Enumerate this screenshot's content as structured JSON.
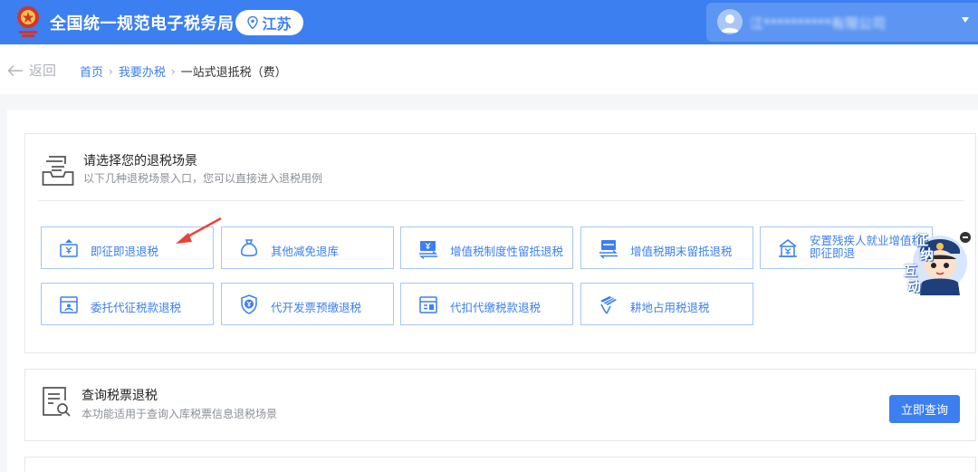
{
  "header": {
    "site_title": "全国统一规范电子税务局",
    "region": "江苏",
    "user_name": "江**********有限公司"
  },
  "breadcrumb": {
    "back_label": "返回",
    "items": [
      "首页",
      "我要办税",
      "一站式退抵税（费）"
    ],
    "separator": "›"
  },
  "refund_scenarios": {
    "title": "请选择您的退税场景",
    "description": "以下几种退税场景入口，您可以直接进入退税用例",
    "tiles": [
      {
        "label": "即征即退退税",
        "icon": "refund-doc-icon"
      },
      {
        "label": "其他减免退库",
        "icon": "money-bag-icon"
      },
      {
        "label": "增值税制度性留抵退税",
        "icon": "yuan-exchange-icon"
      },
      {
        "label": "增值税期末留抵退税",
        "icon": "card-exchange-icon"
      },
      {
        "label": "安置残疾人就业增值税即征即退",
        "line1": "安置残疾人就业增值税",
        "line2": "即征即退",
        "icon": "building-yuan-icon"
      },
      {
        "label": "委托代征税款退税",
        "icon": "commission-icon"
      },
      {
        "label": "代开发票预缴退税",
        "icon": "shield-yuan-icon"
      },
      {
        "label": "代扣代缴税款退税",
        "icon": "withholding-icon"
      },
      {
        "label": "耕地占用税退税",
        "icon": "farmland-icon"
      }
    ]
  },
  "ticket_query": {
    "title": "查询税票退税",
    "description": "本功能适用于查询入库税票信息退税场景",
    "button_label": "立即查询"
  },
  "mascot": {
    "text": [
      "征",
      "纳",
      "互",
      "动"
    ]
  },
  "colors": {
    "brand_blue": "#3c7ff0",
    "tile_border": "#a7c6f5",
    "annotation_red": "#e8443a"
  }
}
